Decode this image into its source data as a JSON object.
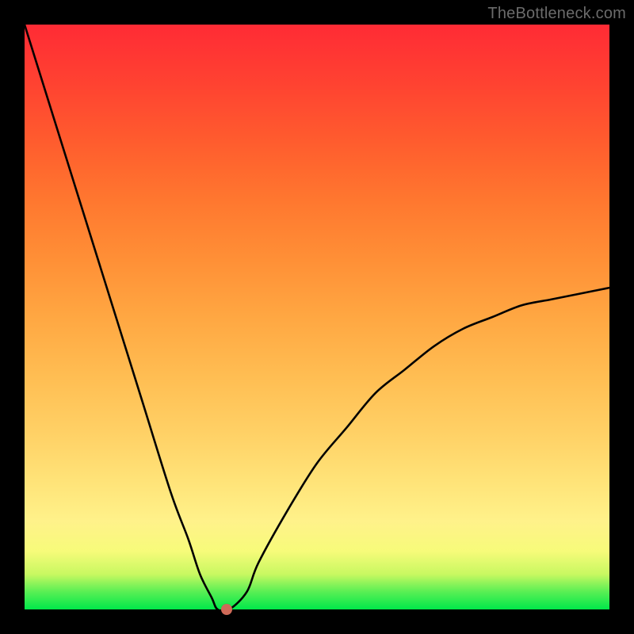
{
  "watermark": "TheBottleneck.com",
  "colors": {
    "frame": "#000000",
    "gradient_top": "#ff2b35",
    "gradient_mid": "#ffc656",
    "gradient_bottom": "#00e84a",
    "curve_stroke": "#000000",
    "dot_fill": "#cf6a58"
  },
  "chart_data": {
    "type": "line",
    "title": "",
    "xlabel": "",
    "ylabel": "",
    "xlim": [
      0,
      1
    ],
    "ylim": [
      0,
      1
    ],
    "note": "Axes are normalized 0–1; no tick labels visible in image. Curve is a V-shaped magnitude function with a sharp minimum near x≈0.33 trending toward ~0.55 at the right edge. A single point marker sits at the valley.",
    "series": [
      {
        "name": "curve",
        "x": [
          0.0,
          0.05,
          0.1,
          0.15,
          0.2,
          0.25,
          0.28,
          0.3,
          0.32,
          0.33,
          0.35,
          0.38,
          0.4,
          0.45,
          0.5,
          0.55,
          0.6,
          0.65,
          0.7,
          0.75,
          0.8,
          0.85,
          0.9,
          0.95,
          1.0
        ],
        "y": [
          1.0,
          0.84,
          0.68,
          0.52,
          0.36,
          0.2,
          0.12,
          0.06,
          0.02,
          0.0,
          0.0,
          0.03,
          0.08,
          0.17,
          0.25,
          0.31,
          0.37,
          0.41,
          0.45,
          0.48,
          0.5,
          0.52,
          0.53,
          0.54,
          0.55
        ]
      }
    ],
    "marker": {
      "x": 0.345,
      "y": 0.0
    }
  }
}
